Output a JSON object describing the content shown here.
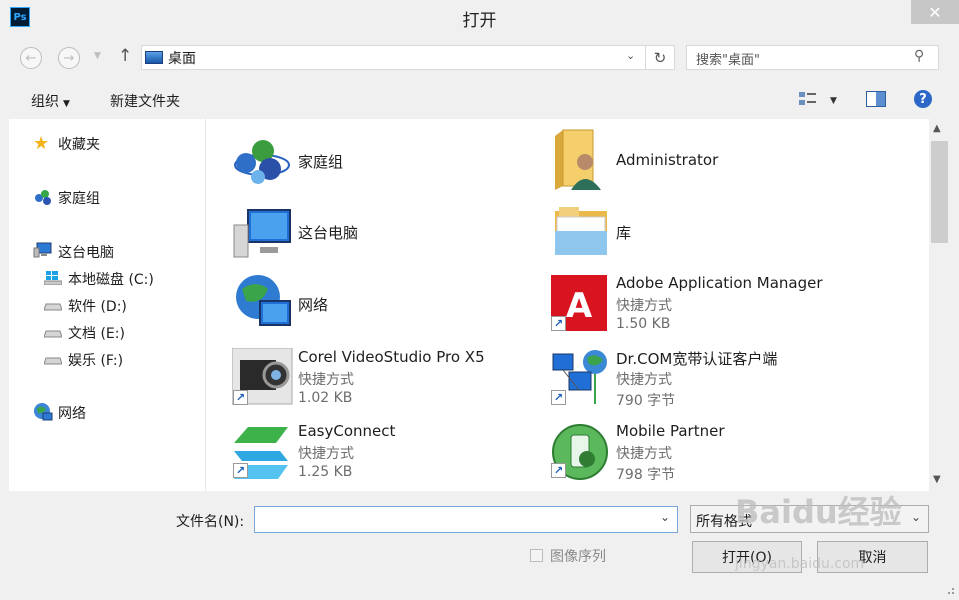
{
  "window": {
    "app_icon_label": "Ps",
    "title": "打开",
    "close_symbol": "✕"
  },
  "nav": {
    "back_icon": "arrow-left-icon",
    "forward_icon": "arrow-right-icon",
    "up_icon": "arrow-up-icon",
    "address": "桌面",
    "search_placeholder": "搜索\"桌面\""
  },
  "toolbar": {
    "organize": "组织",
    "new_folder": "新建文件夹"
  },
  "sidebar": {
    "items": [
      {
        "label": "收藏夹",
        "icon": "star-icon"
      },
      {
        "label": "家庭组",
        "icon": "homegroup-icon"
      },
      {
        "label": "这台电脑",
        "icon": "computer-icon"
      },
      {
        "label": "本地磁盘 (C:)",
        "icon": "windows-drive-icon"
      },
      {
        "label": "软件 (D:)",
        "icon": "drive-icon"
      },
      {
        "label": "文档 (E:)",
        "icon": "drive-icon"
      },
      {
        "label": "娱乐 (F:)",
        "icon": "drive-icon"
      },
      {
        "label": "网络",
        "icon": "network-icon"
      }
    ]
  },
  "content": {
    "items": [
      {
        "name": "家庭组",
        "icon": "homegroup-icon"
      },
      {
        "name": "Administrator",
        "icon": "user-folder-icon"
      },
      {
        "name": "这台电脑",
        "icon": "computer-icon"
      },
      {
        "name": "库",
        "icon": "library-icon"
      },
      {
        "name": "网络",
        "icon": "network-icon"
      },
      {
        "name": "Adobe Application Manager",
        "type": "快捷方式",
        "size": "1.50 KB",
        "icon": "adobe-icon"
      },
      {
        "name": "Corel VideoStudio Pro X5",
        "type": "快捷方式",
        "size": "1.02 KB",
        "icon": "corel-icon"
      },
      {
        "name": "Dr.COM宽带认证客户端",
        "type": "快捷方式",
        "size": "790 字节",
        "icon": "drcom-icon"
      },
      {
        "name": "EasyConnect",
        "type": "快捷方式",
        "size": "1.25 KB",
        "icon": "easyconnect-icon"
      },
      {
        "name": "Mobile Partner",
        "type": "快捷方式",
        "size": "798 字节",
        "icon": "mobile-partner-icon"
      }
    ]
  },
  "bottom": {
    "filename_label": "文件名(N):",
    "filename_value": "",
    "format_value": "所有格式",
    "image_sequence_label": "图像序列",
    "open_button": "打开(O)",
    "cancel_button": "取消"
  },
  "watermark": {
    "text": "Baidu经验",
    "url": "jingyan.baidu.com"
  }
}
